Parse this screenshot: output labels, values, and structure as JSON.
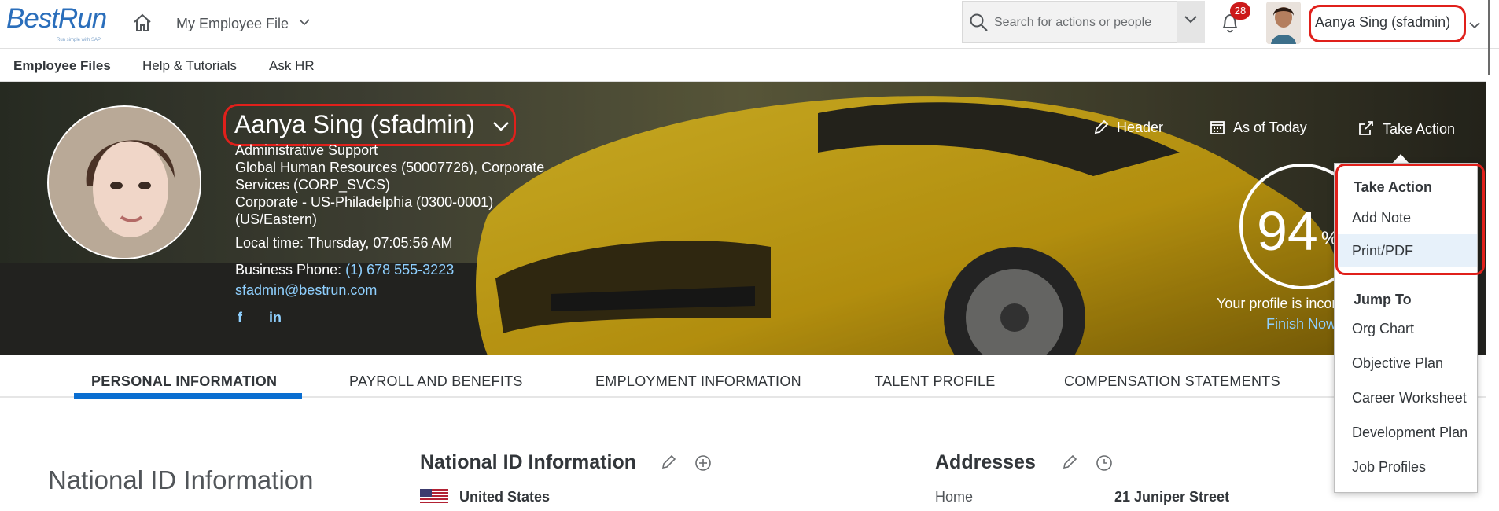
{
  "shell": {
    "logo_text": "BestRun",
    "logo_tagline": "Run simple with SAP",
    "nav_menu_label": "My Employee File",
    "search_placeholder": "Search for actions or people",
    "notification_count": "28",
    "user_display_name": "Aanya Sing (sfadmin)"
  },
  "subnav": {
    "items": [
      "Employee Files",
      "Help & Tutorials",
      "Ask HR"
    ]
  },
  "profile": {
    "name": "Aanya Sing (sfadmin)",
    "job_title": "Administrative Support",
    "department_line1": "Global Human Resources (50007726), Corporate",
    "department_line2": "Services (CORP_SVCS)",
    "location_line1": "Corporate - US-Philadelphia (0300-0001)",
    "location_line2": "(US/Eastern)",
    "local_time": "Local time: Thursday, 07:05:56 AM",
    "business_phone_label": "Business Phone:",
    "business_phone": "(1) 678 555-3223",
    "email": "sfadmin@bestrun.com",
    "social": [
      "f",
      "in"
    ]
  },
  "hero_actions": {
    "header_label": "Header",
    "as_of_label": "As of Today",
    "take_action_label": "Take Action"
  },
  "completion": {
    "percent_text": "94",
    "percent_sign": "%",
    "percent_value": 94,
    "message": "Your profile is incomplete",
    "finish_link": "Finish Now"
  },
  "tabs": [
    "PERSONAL INFORMATION",
    "PAYROLL AND BENEFITS",
    "EMPLOYMENT INFORMATION",
    "TALENT PROFILE",
    "COMPENSATION STATEMENTS"
  ],
  "content": {
    "side_heading": "National ID Information",
    "national_id_title": "National ID Information",
    "country": "United States",
    "addresses_title": "Addresses",
    "address_type": "Home",
    "address_value": "21 Juniper Street"
  },
  "menu": {
    "take_action_header": "Take Action",
    "take_action_items": [
      "Add Note",
      "Print/PDF"
    ],
    "jump_to_header": "Jump To",
    "jump_to_items": [
      "Org Chart",
      "Objective Plan",
      "Career Worksheet",
      "Development Plan",
      "Job Profiles"
    ]
  },
  "colors": {
    "accent": "#0a6ed1",
    "highlight": "#e0201b",
    "badge": "#cc1919",
    "link": "#8fd0ff"
  }
}
